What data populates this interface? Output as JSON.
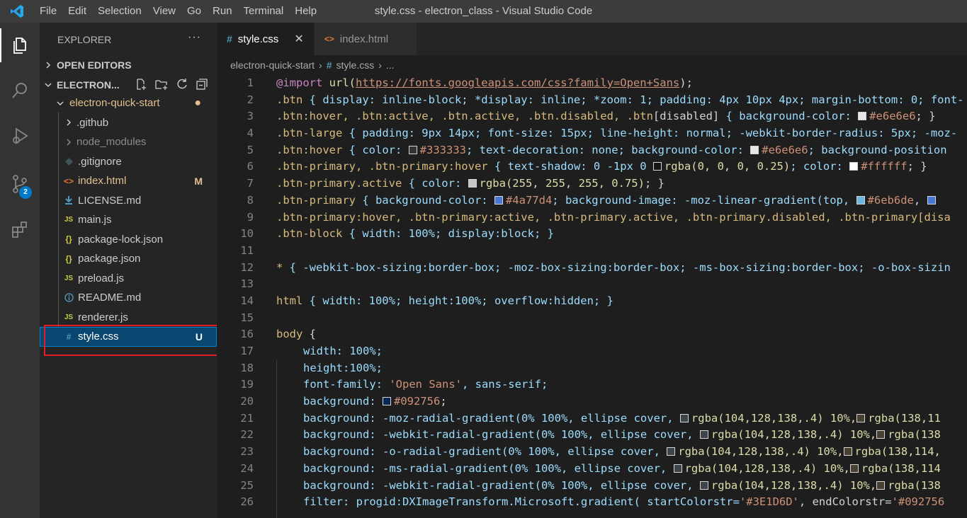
{
  "window": {
    "title": "style.css - electron_class - Visual Studio Code"
  },
  "menu": [
    "File",
    "Edit",
    "Selection",
    "View",
    "Go",
    "Run",
    "Terminal",
    "Help"
  ],
  "activity": {
    "scm_badge": "2"
  },
  "sidebar": {
    "header": "EXPLORER",
    "more": "···",
    "open_editors": "OPEN EDITORS",
    "workspace": "ELECTRON...",
    "folder": "electron-quick-start",
    "items": [
      {
        "label": ".github",
        "kind": "folder",
        "status": ""
      },
      {
        "label": "node_modules",
        "kind": "folder",
        "status": ""
      },
      {
        "label": ".gitignore",
        "kind": "git",
        "status": ""
      },
      {
        "label": "index.html",
        "kind": "html",
        "status": "M"
      },
      {
        "label": "LICENSE.md",
        "kind": "license",
        "status": ""
      },
      {
        "label": "main.js",
        "kind": "js",
        "status": ""
      },
      {
        "label": "package-lock.json",
        "kind": "json",
        "status": ""
      },
      {
        "label": "package.json",
        "kind": "json",
        "status": ""
      },
      {
        "label": "preload.js",
        "kind": "js",
        "status": ""
      },
      {
        "label": "README.md",
        "kind": "info",
        "status": ""
      },
      {
        "label": "renderer.js",
        "kind": "js",
        "status": ""
      },
      {
        "label": "style.css",
        "kind": "css",
        "status": "U"
      }
    ]
  },
  "tabs": [
    {
      "label": "style.css",
      "icon": "#",
      "active": true
    },
    {
      "label": "index.html",
      "icon": "<>",
      "active": false
    }
  ],
  "breadcrumb": {
    "folder": "electron-quick-start",
    "file": "style.css",
    "rest": "..."
  },
  "colors": {
    "accent": "#007acc",
    "selection": "#094771",
    "highlight_box": "#e51c23"
  },
  "code": {
    "numbers": [
      "1",
      "2",
      "3",
      "4",
      "5",
      "6",
      "7",
      "8",
      "9",
      "10",
      "11",
      "12",
      "13",
      "14",
      "15",
      "16",
      "17",
      "18",
      "19",
      "20",
      "21",
      "22",
      "23",
      "24",
      "25",
      "26"
    ],
    "l1_kw": "@import",
    "l1_fn": "url(",
    "l1_url": "https://fonts.googleapis.com/css?family=Open+Sans",
    "l1_end": ");",
    "l2_sel": ".btn",
    "l2_rest": " { display: inline-block; *display: inline; *zoom: 1; padding: 4px 10px 4px; margin-bottom: 0; font-",
    "l3_sel": ".btn:hover, .btn:active, .btn.active, .btn.disabled, .btn",
    "l3_a": "[disabled]",
    "l3_b": " { background-color: ",
    "l3_c": "#e6e6e6",
    "l3_d": "; }",
    "l4_sel": ".btn-large",
    "l4_rest": " { padding: 9px 14px; font-size: 15px; line-height: normal; -webkit-border-radius: 5px; -moz-",
    "l5_sel": ".btn:hover",
    "l5_a": " { color: ",
    "l5_b": "#333333",
    "l5_c": "; text-decoration: none; background-color: ",
    "l5_d": "#e6e6e6",
    "l5_e": "; background-position",
    "l6_sel": ".btn-primary, .btn-primary:hover",
    "l6_a": " { text-shadow: 0 -1px 0 ",
    "l6_b": "rgba(0, 0, 0, 0.25)",
    "l6_c": "; color: ",
    "l6_d": "#ffffff",
    "l6_e": "; }",
    "l7_sel": ".btn-primary.active",
    "l7_a": " { color: ",
    "l7_b": "rgba(255, 255, 255, 0.75)",
    "l7_c": "; }",
    "l8_sel": ".btn-primary",
    "l8_a": " { background-color: ",
    "l8_b": "#4a77d4",
    "l8_c": "; background-image: -moz-linear-gradient(top, ",
    "l8_d": "#6eb6de",
    "l8_e": ", ",
    "l9_sel": ".btn-primary:hover, .btn-primary:active, .btn-primary.active, .btn-primary.disabled, .btn-primary[disa",
    "l10_sel": ".btn-block",
    "l10_rest": " { width: 100%; display:block; }",
    "l12_sel": "*",
    "l12_rest": " { -webkit-box-sizing:border-box; -moz-box-sizing:border-box; -ms-box-sizing:border-box; -o-box-sizin",
    "l14_sel": "html",
    "l14_rest": " { width: 100%; height:100%; overflow:hidden; }",
    "l16_sel": "body",
    "l16_rest": " {",
    "l17": "width: 100%;",
    "l18": "height:100%;",
    "l19_a": "font-family: ",
    "l19_b": "'Open Sans'",
    "l19_c": ", sans-serif;",
    "l20_a": "background: ",
    "l20_b": "#092756",
    "l20_c": ";",
    "l21_a": "background: -moz-radial-gradient(0% 100%, ellipse cover, ",
    "l21_b": "rgba(104,128,138,.4) 10%,",
    "l21_c": "rgba(138,11",
    "l22_a": "background: -webkit-radial-gradient(0% 100%, ellipse cover, ",
    "l22_b": "rgba(104,128,138,.4) 10%,",
    "l22_c": "rgba(138",
    "l23_a": "background: -o-radial-gradient(0% 100%, ellipse cover, ",
    "l23_b": "rgba(104,128,138,.4) 10%,",
    "l23_c": "rgba(138,114,",
    "l24_a": "background: -ms-radial-gradient(0% 100%, ellipse cover, ",
    "l24_b": "rgba(104,128,138,.4) 10%,",
    "l24_c": "rgba(138,114",
    "l25_a": "background: -webkit-radial-gradient(0% 100%, ellipse cover, ",
    "l25_b": "rgba(104,128,138,.4) 10%,",
    "l25_c": "rgba(138",
    "l26_a": "filter: progid:DXImageTransform.Microsoft.gradient( startColorstr=",
    "l26_b": "'#3E1D6D'",
    "l26_c": ", endColorstr=",
    "l26_d": "'#092756"
  }
}
